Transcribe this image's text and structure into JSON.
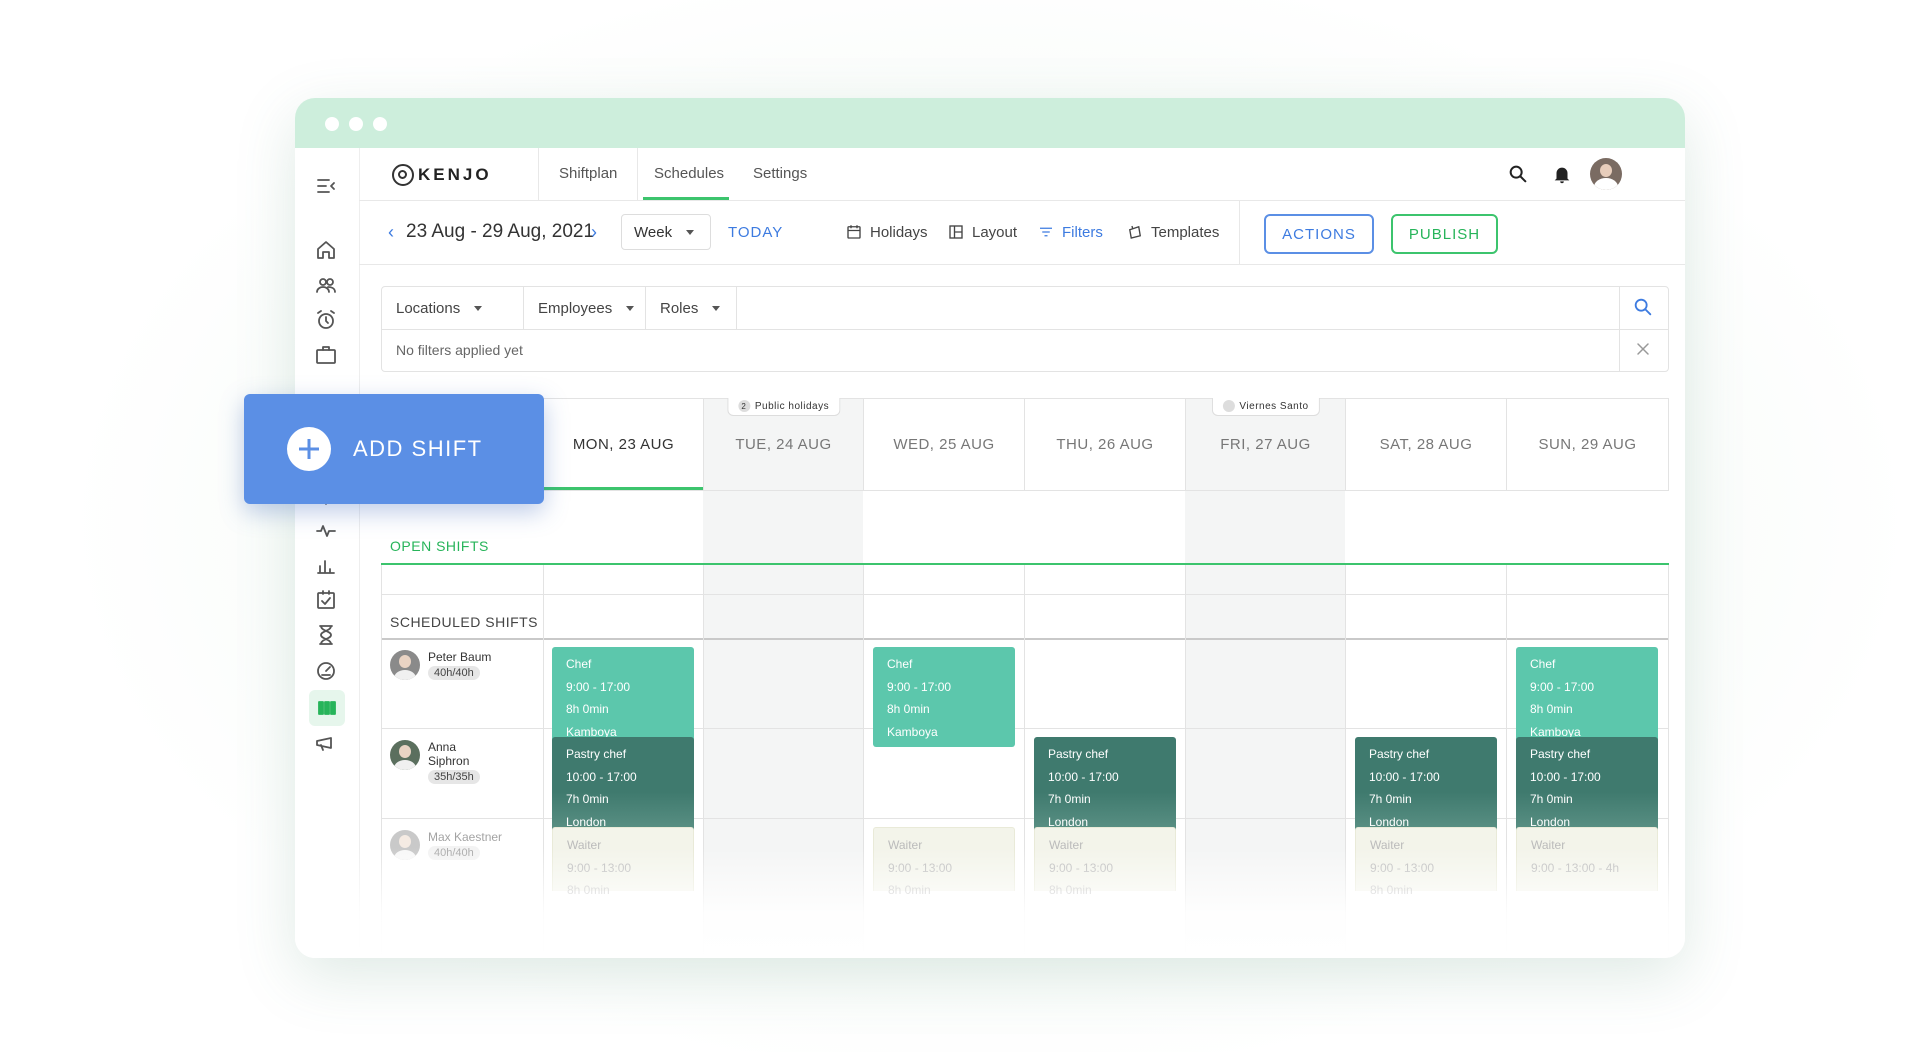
{
  "nav": {
    "logo": "KENJO",
    "tabs": [
      "Shiftplan",
      "Schedules",
      "Settings"
    ],
    "active_tab": "Schedules"
  },
  "toolbar": {
    "date_range": "23 Aug - 29 Aug, 2021",
    "view": "Week",
    "today": "TODAY",
    "holidays": "Holidays",
    "layout": "Layout",
    "filters": "Filters",
    "templates": "Templates",
    "actions": "ACTIONS",
    "publish": "PUBLISH"
  },
  "filters": {
    "locations": "Locations",
    "employees": "Employees",
    "roles": "Roles",
    "empty": "No filters applied yet"
  },
  "add_shift": "ADD SHIFT",
  "days": [
    {
      "label": "MON, 23 AUG",
      "badge": ""
    },
    {
      "label": "TUE, 24 AUG",
      "badge": "Public holidays",
      "badge_count": "2"
    },
    {
      "label": "WED, 25 AUG",
      "badge": ""
    },
    {
      "label": "THU, 26 AUG",
      "badge": ""
    },
    {
      "label": "FRI, 27 AUG",
      "badge": "Viernes Santo"
    },
    {
      "label": "SAT, 28 AUG",
      "badge": ""
    },
    {
      "label": "SUN, 29 AUG",
      "badge": ""
    }
  ],
  "sections": {
    "open": "OPEN SHIFTS",
    "scheduled": "SCHEDULED SHIFTS"
  },
  "employees": [
    {
      "name": "Peter Baum",
      "hours": "40h/40h"
    },
    {
      "name": "Anna Siphron",
      "hours": "35h/35h"
    },
    {
      "name": "Max Kaestner",
      "hours": "40h/40h"
    }
  ],
  "shifts": {
    "chef": {
      "role": "Chef",
      "time": "9:00 - 17:00",
      "duration": "8h 0min",
      "location": "Kamboya"
    },
    "pastry": {
      "role": "Pastry chef",
      "time": "10:00 - 17:00",
      "duration": "7h 0min",
      "location": "London"
    },
    "waiter": {
      "role": "Waiter",
      "time": "9:00 - 13:00",
      "duration": "8h 0min"
    },
    "waiter_sun": {
      "role": "Waiter",
      "time": "9:00 - 13:00 - 4h"
    }
  },
  "colors": {
    "accent_green": "#3cc46d",
    "primary_blue": "#5b8fe5",
    "chef_card": "#5cc7ac",
    "pastry_card": "#3f7a6e",
    "titlebar": "#cdeedc"
  }
}
